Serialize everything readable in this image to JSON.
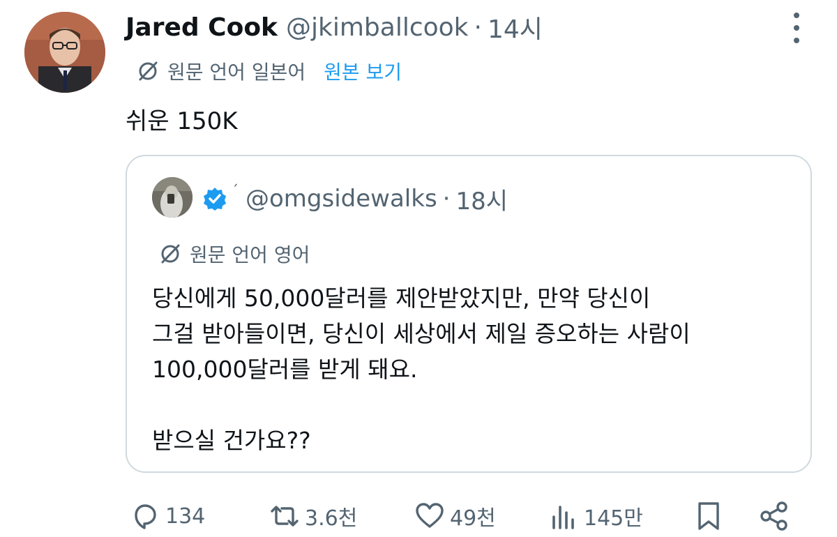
{
  "tweet": {
    "author_name": "Jared Cook",
    "author_handle": "@jkimballcook",
    "separator": "·",
    "time": "14시",
    "original_language_label": "원문 언어 일본어",
    "view_original_label": "원본 보기",
    "text": "쉬운 150K"
  },
  "quote": {
    "handle": "@omgsidewalks",
    "separator": "·",
    "time": "18시",
    "name_mark": "ˊ",
    "original_language_label": "원문 언어 영어",
    "lines": [
      "당신에게 50,000달러를 제안받았지만, 만약 당신이",
      "그걸 받아들이면, 당신이 세상에서 제일 증오하는 사람이",
      "100,000달러를 받게 돼요.",
      "받으실 건가요??"
    ]
  },
  "actions": {
    "replies": "134",
    "retweets": "3.6천",
    "likes": "49천",
    "views": "145만"
  },
  "icons": {
    "translate": "translate-icon",
    "verified": "verified-badge-icon",
    "reply": "reply-icon",
    "retweet": "retweet-icon",
    "like": "heart-icon",
    "views": "views-icon",
    "bookmark": "bookmark-icon",
    "share": "share-icon",
    "more": "more-options-icon"
  },
  "colors": {
    "link": "#1d9bf0",
    "muted": "#536471",
    "text": "#0f1419",
    "verified": "#1d9bf0",
    "border": "#cfd9de"
  }
}
